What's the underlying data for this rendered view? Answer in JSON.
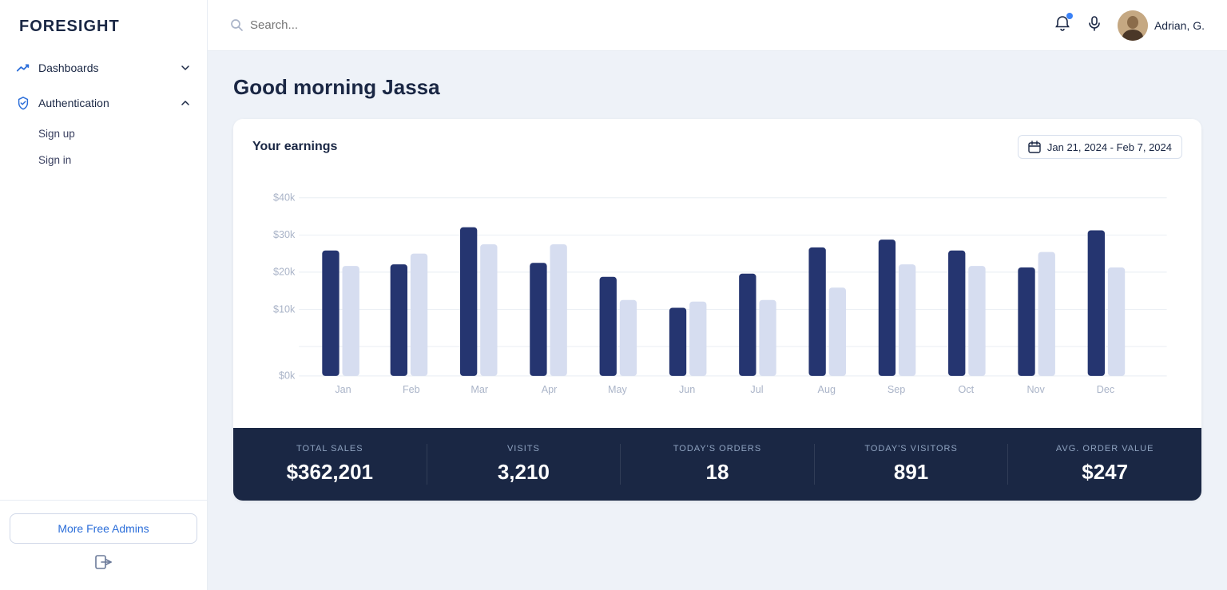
{
  "app": {
    "logo": "FORESIGHT"
  },
  "sidebar": {
    "nav_items": [
      {
        "id": "dashboards",
        "label": "Dashboards",
        "icon": "chart-icon",
        "has_children": true,
        "expanded": false
      },
      {
        "id": "authentication",
        "label": "Authentication",
        "icon": "shield-icon",
        "has_children": true,
        "expanded": true
      }
    ],
    "auth_sub_items": [
      {
        "id": "signup",
        "label": "Sign up"
      },
      {
        "id": "signin",
        "label": "Sign in"
      }
    ],
    "more_admins_label": "More Free Admins",
    "logout_icon": "logout-icon"
  },
  "header": {
    "search_placeholder": "Search...",
    "user_name": "Adrian, G."
  },
  "main": {
    "greeting": "Good morning Jassa",
    "card": {
      "title": "Your earnings",
      "date_range": "Jan 21, 2024 - Feb 7, 2024"
    },
    "chart": {
      "y_labels": [
        "$40k",
        "$30k",
        "$20k",
        "$10k",
        "$0k"
      ],
      "x_labels": [
        "Jan",
        "Feb",
        "Mar",
        "Apr",
        "May",
        "Jun",
        "Jul",
        "Aug",
        "Sep",
        "Oct",
        "Nov",
        "Dec"
      ],
      "bars_dark": [
        25,
        20,
        33,
        21,
        16,
        8,
        17,
        26,
        28,
        25,
        19,
        31
      ],
      "bars_light": [
        22,
        24,
        27,
        27,
        12,
        11,
        11,
        16,
        19,
        22,
        24,
        17
      ]
    },
    "stats": [
      {
        "id": "total_sales",
        "label": "TOTAL SALES",
        "value": "$362,201"
      },
      {
        "id": "visits",
        "label": "VISITS",
        "value": "3,210"
      },
      {
        "id": "todays_orders",
        "label": "TODAY'S ORDERS",
        "value": "18"
      },
      {
        "id": "todays_visitors",
        "label": "TODAY'S VISITORS",
        "value": "891"
      },
      {
        "id": "avg_order_value",
        "label": "AVG. ORDER VALUE",
        "value": "$247"
      }
    ]
  },
  "colors": {
    "bar_dark": "#253570",
    "bar_light": "#d6ddf0",
    "grid_line": "#e8edf3"
  }
}
